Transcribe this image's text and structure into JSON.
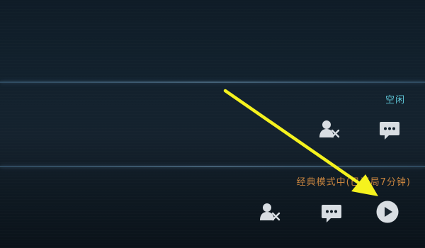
{
  "rows": [
    {
      "status_text": "空闲",
      "status_color": "#5fc7d8",
      "actions": [
        {
          "icon": "kick-user-icon",
          "label": ""
        },
        {
          "icon": "chat-icon",
          "label": ""
        }
      ]
    },
    {
      "status_text": "经典模式中(已开局7分钟)",
      "status_color": "#c9853f",
      "actions": [
        {
          "icon": "kick-user-icon",
          "label": ""
        },
        {
          "icon": "chat-icon",
          "label": ""
        },
        {
          "icon": "spectate-play-icon",
          "label": ""
        }
      ]
    }
  ],
  "annotation": {
    "arrow_color": "#f5f21e",
    "points_to": "spectate-play-icon"
  },
  "colors": {
    "background": "#12212d",
    "icon": "#d8dde2",
    "divider": "#6e96b4"
  }
}
